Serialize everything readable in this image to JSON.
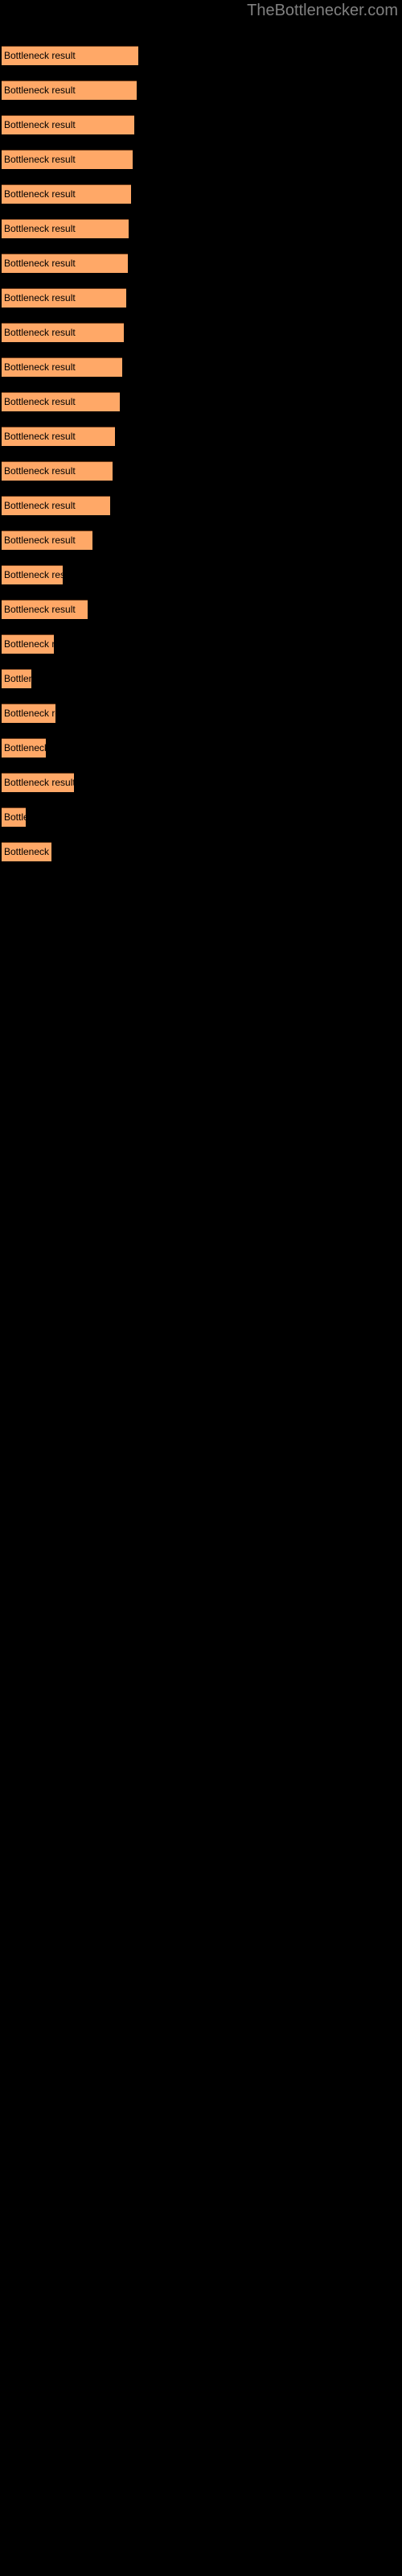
{
  "site": {
    "title": "TheBottlenecker.com",
    "title_color": "#808080"
  },
  "theme": {
    "background": "#000000",
    "bar_color": "#FFA867",
    "bar_border": "#6B3B1A",
    "label_color": "#000000"
  },
  "chart_data": {
    "type": "bar",
    "orientation": "horizontal",
    "title": "",
    "xlabel": "",
    "ylabel": "",
    "grid": false,
    "legend": null,
    "bar_label_text": "Bottleneck result",
    "categories": [
      "Bottleneck result",
      "Bottleneck result",
      "Bottleneck result",
      "Bottleneck result",
      "Bottleneck result",
      "Bottleneck result",
      "Bottleneck result",
      "Bottleneck result",
      "Bottleneck result",
      "Bottleneck result",
      "Bottleneck result",
      "Bottleneck result",
      "Bottleneck result",
      "Bottleneck result",
      "Bottleneck result",
      "Bottleneck result",
      "Bottleneck result",
      "Bottleneck result",
      "Bottleneck result",
      "Bottleneck result",
      "Bottleneck result",
      "Bottleneck result",
      "Bottleneck result"
    ],
    "values": [
      170,
      168,
      165,
      163,
      161,
      158,
      157,
      155,
      152,
      150,
      147,
      141,
      138,
      135,
      118,
      88,
      115,
      79,
      51,
      80,
      68,
      102,
      42,
      86
    ],
    "xlim": [
      0,
      500
    ],
    "bars": [
      {
        "index": 1,
        "y": 57,
        "width": 170,
        "label": "Bottleneck result"
      },
      {
        "index": 2,
        "y": 100,
        "width": 168,
        "label": "Bottleneck result"
      },
      {
        "index": 3,
        "y": 143,
        "width": 165,
        "label": "Bottleneck result"
      },
      {
        "index": 4,
        "y": 186,
        "width": 163,
        "label": "Bottleneck result"
      },
      {
        "index": 5,
        "y": 229,
        "width": 161,
        "label": "Bottleneck result"
      },
      {
        "index": 6,
        "y": 272,
        "width": 158,
        "label": "Bottleneck result"
      },
      {
        "index": 7,
        "y": 315,
        "width": 157,
        "label": "Bottleneck result"
      },
      {
        "index": 8,
        "y": 358,
        "width": 155,
        "label": "Bottleneck result"
      },
      {
        "index": 9,
        "y": 401,
        "width": 152,
        "label": "Bottleneck result"
      },
      {
        "index": 10,
        "y": 444,
        "width": 150,
        "label": "Bottleneck result"
      },
      {
        "index": 11,
        "y": 487,
        "width": 147,
        "label": "Bottleneck result"
      },
      {
        "index": 12,
        "y": 530,
        "width": 141,
        "label": "Bottleneck result"
      },
      {
        "index": 13,
        "y": 573,
        "width": 138,
        "label": "Bottleneck result"
      },
      {
        "index": 14,
        "y": 616,
        "width": 135,
        "label": "Bottleneck result"
      },
      {
        "index": 15,
        "y": 659,
        "width": 113,
        "label": "Bottleneck result"
      },
      {
        "index": 16,
        "y": 702,
        "width": 76,
        "label": "Bottleneck result"
      },
      {
        "index": 17,
        "y": 745,
        "width": 107,
        "label": "Bottleneck result"
      },
      {
        "index": 18,
        "y": 788,
        "width": 65,
        "label": "Bottleneck result"
      },
      {
        "index": 19,
        "y": 831,
        "width": 37,
        "label": "Bottleneck result"
      },
      {
        "index": 20,
        "y": 874,
        "width": 67,
        "label": "Bottleneck result"
      },
      {
        "index": 21,
        "y": 917,
        "width": 55,
        "label": "Bottleneck result"
      },
      {
        "index": 22,
        "y": 960,
        "width": 90,
        "label": "Bottleneck result"
      },
      {
        "index": 23,
        "y": 1003,
        "width": 30,
        "label": "Bottleneck result"
      },
      {
        "index": 24,
        "y": 1046,
        "width": 62,
        "label": "Bottleneck result"
      }
    ]
  }
}
